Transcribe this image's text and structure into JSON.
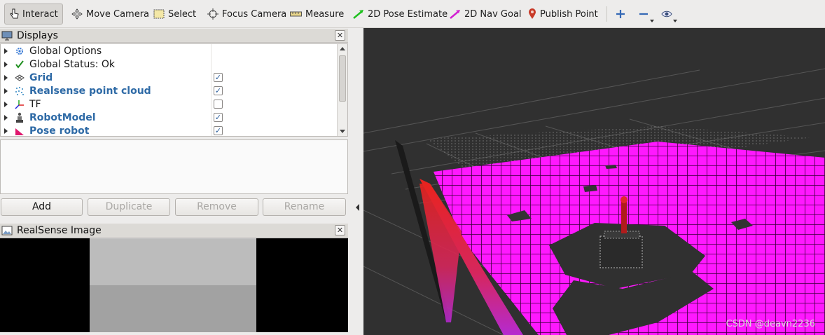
{
  "toolbar": {
    "interact": "Interact",
    "move_camera": "Move Camera",
    "select": "Select",
    "focus_camera": "Focus Camera",
    "measure": "Measure",
    "pose_estimate": "2D Pose Estimate",
    "nav_goal": "2D Nav Goal",
    "publish_point": "Publish Point"
  },
  "displays_panel": {
    "title": "Displays",
    "items": [
      {
        "label": "Global Options",
        "icon": "gear-icon",
        "checkbox": null,
        "enabled": false
      },
      {
        "label": "Global Status: Ok",
        "icon": "check-icon",
        "checkbox": null,
        "enabled": false
      },
      {
        "label": "Grid",
        "icon": "grid-icon",
        "checkbox": true,
        "enabled": true
      },
      {
        "label": "Realsense point cloud",
        "icon": "pointcloud-icon",
        "checkbox": true,
        "enabled": true
      },
      {
        "label": "TF",
        "icon": "tf-axes-icon",
        "checkbox": false,
        "enabled": false
      },
      {
        "label": "RobotModel",
        "icon": "robot-icon",
        "checkbox": true,
        "enabled": true
      },
      {
        "label": "Pose robot",
        "icon": "pose-arrow-icon",
        "checkbox": true,
        "enabled": true
      }
    ],
    "buttons": {
      "add": "Add",
      "duplicate": "Duplicate",
      "remove": "Remove",
      "rename": "Rename"
    }
  },
  "image_panel": {
    "title": "RealSense Image"
  },
  "viewport": {
    "watermark": "CSDN @deavn2236"
  },
  "colors": {
    "cloud_magenta": "#ff18ff",
    "cloud_red": "#e8231e",
    "background": "#303030"
  }
}
